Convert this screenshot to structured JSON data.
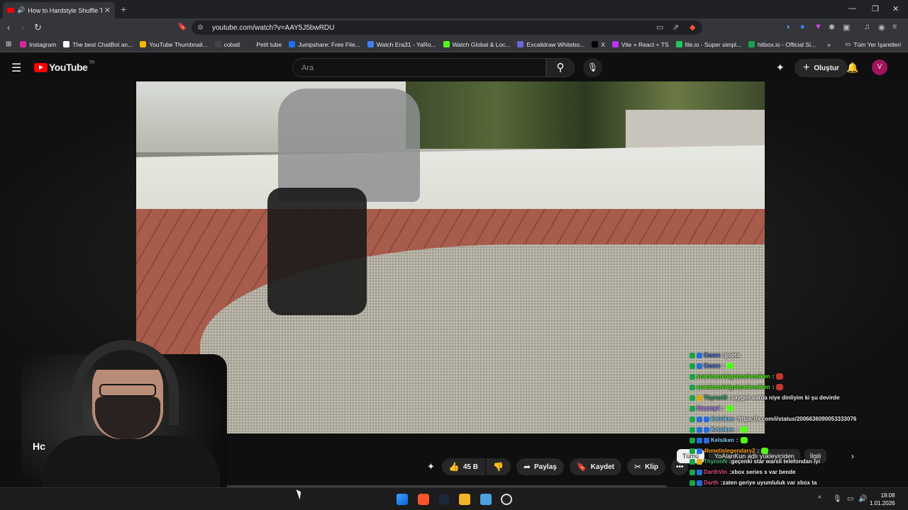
{
  "browser": {
    "tab_title": "How to Hardstyle Shuffle Tut",
    "url": "youtube.com/watch?v=AAY5J5bwRDU",
    "bookmarks": [
      {
        "label": "Instagram",
        "color": "#d6249f"
      },
      {
        "label": "The best ChatBot an...",
        "color": "#ffffff"
      },
      {
        "label": "YouTube Thumbnail...",
        "color": "#f2b705"
      },
      {
        "label": "cobalt",
        "color": "#444444"
      },
      {
        "label": "Petit tube",
        "color": "#333333"
      },
      {
        "label": "Jumpshare: Free File...",
        "color": "#1f6feb"
      },
      {
        "label": "Watch Era31 - YaRo...",
        "color": "#3b82f6"
      },
      {
        "label": "Watch Global & Loc...",
        "color": "#53fc18"
      },
      {
        "label": "Excalidraw Whitebo...",
        "color": "#6965db"
      },
      {
        "label": "X",
        "color": "#000000"
      },
      {
        "label": "Vite + React + TS",
        "color": "#bd34fe"
      },
      {
        "label": "file.io - Super simpl...",
        "color": "#22c55e"
      },
      {
        "label": "hitbox.io - Official Si...",
        "color": "#16a34a"
      }
    ],
    "bookmarks_all": "Tüm Yer İşaretleri"
  },
  "youtube": {
    "logo_text": "YouTube",
    "region": "TR",
    "search_placeholder": "Ara",
    "create_label": "Oluştur",
    "avatar_letter": "V"
  },
  "video": {
    "title_fragment": "Hc",
    "likes": "45 B",
    "share_label": "Paylaş",
    "save_label": "Kaydet",
    "clip_label": "Klip"
  },
  "chips": [
    "Tümü",
    "YoAlanKun adlı yükleyiciden",
    "İlgili"
  ],
  "chat": [
    {
      "user": "Caxxx",
      "msg": "gopta",
      "color": "#4a6ee0",
      "badges": [
        "g",
        "b"
      ],
      "emoji": ""
    },
    {
      "user": "Caxxx",
      "msg": "",
      "color": "#4a6ee0",
      "badges": [
        "g",
        "b"
      ],
      "emoji": "#53fc18"
    },
    {
      "user": "ananinaminigotundensiken",
      "msg": "",
      "color": "#53fc18",
      "badges": [
        "g"
      ],
      "emoji": "#c0392b"
    },
    {
      "user": "ananinaminigotundensiken",
      "msg": "",
      "color": "#53fc18",
      "badges": [
        "g"
      ],
      "emoji": "#c0392b"
    },
    {
      "user": "ThyronN",
      "msg": "saygım varda niye dinliyim ki şu devirde",
      "color": "#3cb371",
      "badges": [
        "g",
        "y"
      ],
      "emoji": ""
    },
    {
      "user": "Hasany4",
      "msg": "",
      "color": "#b38cff",
      "badges": [
        "g"
      ],
      "emoji": "#53fc18"
    },
    {
      "user": "Kelsiken",
      "msg": "https://x.com/i/status/2006636090053333076",
      "color": "#7fd4ff",
      "badges": [
        "g",
        "b",
        "b"
      ],
      "emoji": ""
    },
    {
      "user": "Kelsiken",
      "msg": "",
      "color": "#7fd4ff",
      "badges": [
        "g",
        "b",
        "b"
      ],
      "emoji": "#53fc18"
    },
    {
      "user": "Kelsiken",
      "msg": "",
      "color": "#7fd4ff",
      "badges": [
        "g",
        "b",
        "b"
      ],
      "emoji": "#53fc18"
    },
    {
      "user": "4hmetislegendary2",
      "msg": "",
      "color": "#ff9f1a",
      "badges": [
        "g",
        "b"
      ],
      "emoji": "#53fc18"
    },
    {
      "user": "ThyronN",
      "msg": "geçenki star warsli telefondan iyi",
      "color": "#3cb371",
      "badges": [
        "g",
        "y"
      ],
      "emoji": ""
    },
    {
      "user": "DarthVin",
      "msg": "xbox series s var bende",
      "color": "#e0507a",
      "badges": [
        "g",
        "b"
      ],
      "emoji": ""
    },
    {
      "user": "Darth",
      "msg": "zaten geriye uyumluluk var xbox ta",
      "color": "#e0507a",
      "badges": [
        "g",
        "b"
      ],
      "emoji": ""
    },
    {
      "user": "4hmetislegendary2",
      "msg": "",
      "color": "#ff9f1a",
      "badges": [
        "g",
        "b"
      ],
      "emoji": "#f5deb3"
    },
    {
      "user": "4hmetislegendary2",
      "msg": "",
      "color": "#ff9f1a",
      "badges": [
        "g",
        "b"
      ],
      "emoji": "#f5deb3"
    }
  ],
  "taskbar": {
    "time": "19:08",
    "date": "1.01.2026"
  }
}
